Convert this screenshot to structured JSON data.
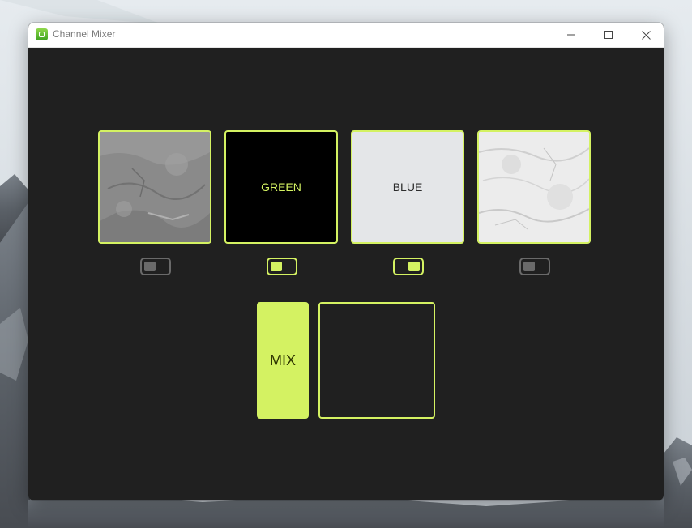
{
  "window": {
    "title": "Channel Mixer"
  },
  "titlebar": {
    "app_icon": "app-icon",
    "controls": [
      "minimize-icon",
      "maximize-icon",
      "close-icon"
    ]
  },
  "channels": [
    {
      "label": "",
      "kind": "texture-dark",
      "enabled": false
    },
    {
      "label": "GREEN",
      "kind": "color",
      "enabled": true
    },
    {
      "label": "BLUE",
      "kind": "color",
      "enabled": true
    },
    {
      "label": "",
      "kind": "texture-light",
      "enabled": false
    }
  ],
  "mix": {
    "button_label": "MIX"
  },
  "colors": {
    "accent": "#d4f262",
    "window_bg": "#202020",
    "toggle_off": "#6a6a6a",
    "green_card_bg": "#000000",
    "blue_card_bg": "#e4e6e8"
  }
}
